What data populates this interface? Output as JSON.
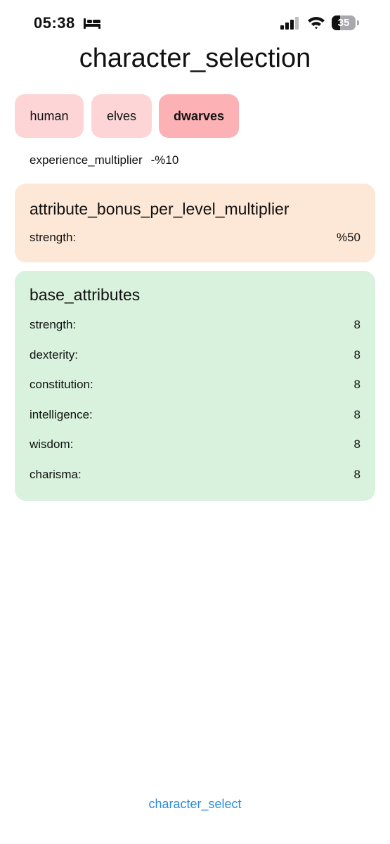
{
  "status_bar": {
    "time": "05:38",
    "battery_level": "35",
    "battery_fraction": 0.35
  },
  "title": "character_selection",
  "races": [
    {
      "label": "human",
      "selected": false
    },
    {
      "label": "elves",
      "selected": false
    },
    {
      "label": "dwarves",
      "selected": true
    }
  ],
  "experience": {
    "label": "experience_multiplier",
    "value": "-%10"
  },
  "attribute_bonus": {
    "title": "attribute_bonus_per_level_multiplier",
    "rows": [
      {
        "label": "strength:",
        "value": "%50"
      }
    ]
  },
  "base_attributes": {
    "title": "base_attributes",
    "rows": [
      {
        "label": "strength:",
        "value": "8"
      },
      {
        "label": "dexterity:",
        "value": "8"
      },
      {
        "label": "constitution:",
        "value": "8"
      },
      {
        "label": "intelligence:",
        "value": "8"
      },
      {
        "label": "wisdom:",
        "value": "8"
      },
      {
        "label": "charisma:",
        "value": "8"
      }
    ]
  },
  "bottom_link": "character_select",
  "colors": {
    "tab_bg": "#fdd5d6",
    "tab_selected_bg": "#fcb2b5",
    "bonus_card_bg": "#fde7d6",
    "base_card_bg": "#d8f2dd",
    "link": "#2b8be0"
  },
  "icons": [
    "bed-icon",
    "cellular-signal-icon",
    "wifi-icon",
    "battery-icon"
  ]
}
